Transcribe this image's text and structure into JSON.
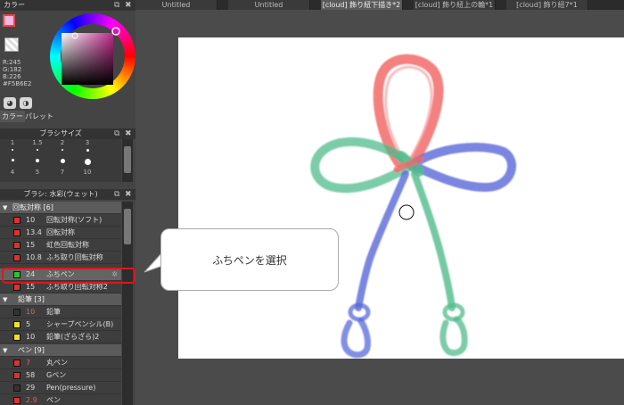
{
  "tabs": [
    "Untitled",
    "Untitled",
    "[cloud] 飾り紐下描き*2",
    "[cloud] 飾り紐上の輪*1",
    "[cloud] 飾り紐7*1"
  ],
  "active_tab": 2,
  "color_panel": {
    "title": "カラー",
    "current_color": "#F5B6E2",
    "rgb": [
      "R:245",
      "G:182",
      "B:226",
      "#F5B6E2"
    ],
    "tabs": [
      "カラー",
      "パレット"
    ]
  },
  "brush_size": {
    "title": "ブラシサイズ",
    "sizes": [
      "1",
      "1.5",
      "2",
      "3",
      "4",
      "5",
      "7",
      "10"
    ]
  },
  "brush_list": {
    "title": "ブラシ: 水彩(ウェット)",
    "groups": [
      {
        "name": "回転対称 [6]",
        "items": [
          {
            "color": "#e03030",
            "size": "10",
            "name": "回転対称(ソフト)"
          },
          {
            "color": "#e03030",
            "size": "13.4",
            "name": "回転対称"
          },
          {
            "color": "#e03030",
            "size": "15",
            "name": "虹色回転対称"
          },
          {
            "color": "#e03030",
            "size": "10.8",
            "name": "ふち取り回転対称"
          },
          {
            "color": "#2ec22e",
            "size": "24",
            "name": "ふちペン"
          },
          {
            "color": "#e03030",
            "size": "15",
            "name": "ふち取り回転対称2"
          }
        ]
      },
      {
        "name": "鉛筆 [3]",
        "items": [
          {
            "color": "#333333",
            "size": "10",
            "name": "鉛筆"
          },
          {
            "color": "#f0e020",
            "size": "5",
            "name": "シャープペンシル(B)"
          },
          {
            "color": "#f0e020",
            "size": "10",
            "name": "鉛筆(ざらざら)2"
          }
        ]
      },
      {
        "name": "ペン [9]",
        "items": [
          {
            "color": "#e03030",
            "size": "7",
            "name": "丸ペン"
          },
          {
            "color": "#e03030",
            "size": "58",
            "name": "Gペン"
          },
          {
            "color": "#333333",
            "size": "29",
            "name": "Pen(pressure)"
          },
          {
            "color": "#e03030",
            "size": "2.9",
            "name": "ペン"
          }
        ]
      }
    ],
    "selected": "ふちペン"
  },
  "callout": {
    "text": "ふちペンを選択"
  }
}
